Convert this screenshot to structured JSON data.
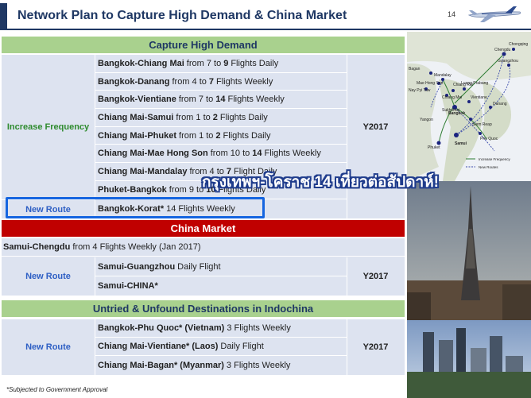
{
  "title": "Network Plan to Capture High Demand & China Market",
  "page_number": "14",
  "sections": {
    "high_demand": {
      "header": "Capture High Demand",
      "increase_label": "Increase Frequency",
      "new_label": "New Route",
      "year": "Y2017",
      "rows": [
        {
          "route": "Bangkok-Chiang Mai",
          "pre": "from 7 to",
          "num": "9",
          "post": "Flights Daily"
        },
        {
          "route": "Bangkok-Danang",
          "pre": "from 4 to",
          "num": "7",
          "post": "Flights Weekly"
        },
        {
          "route": "Bangkok-Vientiane",
          "pre": "from 7 to",
          "num": "14",
          "post": "Flights Weekly"
        },
        {
          "route": "Chiang Mai-Samui",
          "pre": "from 1 to",
          "num": "2",
          "post": "Flights Daily"
        },
        {
          "route": "Chiang Mai-Phuket",
          "pre": "from 1 to",
          "num": "2",
          "post": "Flights Daily"
        },
        {
          "route": "Chiang Mai-Mae Hong Son",
          "pre": "from 10 to",
          "num": "14",
          "post": "Flights Weekly"
        },
        {
          "route": "Chiang Mai-Mandalay",
          "pre": "from 4 to",
          "num": "7",
          "post": "Flight Daily"
        },
        {
          "route": "Phuket-Bangkok",
          "pre": "from 9 to",
          "num": "10",
          "post": "Flights Daily"
        }
      ],
      "new_row": {
        "route": "Bangkok-Korat*",
        "detail": "14 Flights Weekly"
      }
    },
    "china": {
      "header": "China Market",
      "top_row": {
        "route": "Samui-Chengdu",
        "detail": "from 4 Flights Weekly (Jan 2017)"
      },
      "label": "New Route",
      "year": "Y2017",
      "rows": [
        {
          "route": "Samui-Guangzhou",
          "detail": "Daily Flight"
        },
        {
          "route": "Samui-CHINA*",
          "detail": ""
        }
      ]
    },
    "indochina": {
      "header": "Untried & Unfound Destinations in Indochina",
      "label": "New Route",
      "year": "Y2017",
      "rows": [
        {
          "route": "Bangkok-Phu Quoc* (Vietnam)",
          "detail": "3 Flights Weekly"
        },
        {
          "route": "Chiang Mai-Vientiane* (Laos)",
          "detail": "Daily Flight"
        },
        {
          "route": "Chiang Mai-Bagan* (Myanmar)",
          "detail": "3 Flights Weekly"
        }
      ]
    }
  },
  "overlay_text": "กรุงเทพฯ-โคราช 14 เที่ยวต่อสัปดาห์!",
  "footnote": "*Subjected to Government Approval",
  "map": {
    "cities": [
      "Chengdu",
      "Chongqing",
      "Guangzhou",
      "Bagan",
      "Mandalay",
      "Nay Pyi Taw",
      "Mae Hong Son",
      "Chiang Rai",
      "Chiang Mai",
      "Luang Prabang",
      "Vientiane",
      "Sukhothai",
      "Danang",
      "Yangon",
      "Bangkok",
      "Siem Reap",
      "Phuket",
      "Samui",
      "Phu Quoc"
    ],
    "legend": [
      "Increase Frequency",
      "New Routes"
    ]
  },
  "colors": {
    "navy": "#1f3864",
    "green_header": "#a9d18e",
    "red_header": "#c00000",
    "row_bg": "#dde3f0",
    "highlight": "#1565e0"
  }
}
